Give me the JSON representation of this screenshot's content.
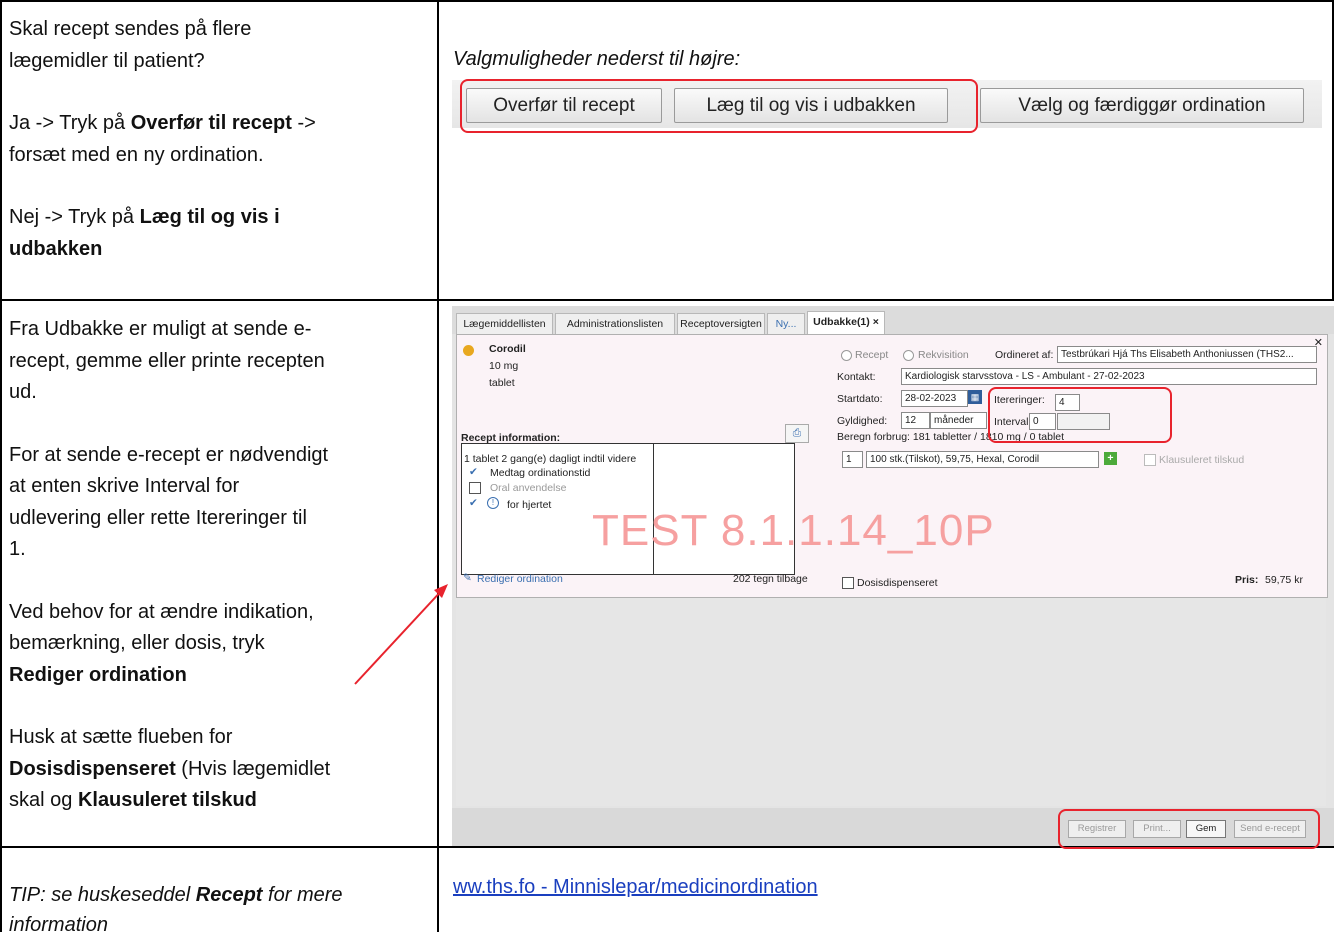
{
  "row1": {
    "question": [
      "Skal recept sendes på flere",
      "lægemidler til patient?"
    ],
    "yes_prefix": "Ja -> Tryk på ",
    "yes_bold": "Overfør til recept",
    "yes_suffix": " ->",
    "yes_line2": "forsæt med en ny ordination.",
    "no_prefix": "Nej -> Tryk på ",
    "no_bold1": "Læg til og vis i",
    "no_bold2": "udbakken",
    "options_label": "Valgmuligheder nederst til højre:",
    "buttons": [
      "Overfør til recept",
      "Læg til og vis i udbakken",
      "Vælg og færdiggør ordination"
    ]
  },
  "row2": {
    "p1": [
      "Fra Udbakke er muligt at sende e-",
      "recept, gemme eller printe recepten",
      "ud."
    ],
    "p2": [
      "For at sende e-recept er nødvendigt",
      "at enten skrive Interval for",
      "udlevering eller rette Itereringer til",
      "1."
    ],
    "p3": [
      "Ved behov for at ændre indikation,",
      "bemærkning, eller dosis, tryk"
    ],
    "p3_bold": "Rediger ordination",
    "p4_line1": "Husk at sætte flueben for",
    "p4_bold1": "Dosisdispenseret",
    "p4_rest1": " (Hvis lægemidlet",
    "p4_line3_prefix": "skal og ",
    "p4_bold2": "Klausuleret tilskud"
  },
  "screenshot": {
    "tabs": [
      "Lægemiddellisten",
      "Administrationslisten",
      "Receptoversigten",
      "Ny...",
      "Udbakke(1) ×"
    ],
    "drug_name": "Corodil",
    "strength": "10 mg",
    "form": "tablet",
    "recept_info": "Recept information:",
    "dosage": "1 tablet 2 gang(e) dagligt  indtil videre",
    "medtag": "Medtag ordinationstid",
    "oral": "Oral anvendelse",
    "indication": "for hjertet",
    "rediger": "Rediger ordination",
    "tegn": "202 tegn tilbage",
    "radio_recept": "Recept",
    "radio_rekvisition": "Rekvisition",
    "ordineret_label": "Ordineret af:",
    "ordineret_value": "Testbrúkari Hjá Ths Elisabeth Anthoniussen (THS2...",
    "kontakt_label": "Kontakt:",
    "kontakt_value": "Kardiologisk starvsstova - LS - Ambulant -  27-02-2023",
    "startdato_label": "Startdato:",
    "startdato_value": "28-02-2023",
    "itereringer_label": "Itereringer:",
    "itereringer_value": "4",
    "gyldighed_label": "Gyldighed:",
    "gyldighed_value": "12",
    "gyldighed_unit": "måneder",
    "interval_label": "Interval:",
    "interval_value": "0",
    "forbrug": "Beregn forbrug: 181 tabletter / 1810 mg / 0 tablet",
    "pakning_qty": "1",
    "pakning": "100 stk.(Tilskot), 59,75, Hexal, Corodil",
    "klausuleret": "Klausuleret tilskud",
    "dosisdisp": "Dosisdispenseret",
    "pris_label": "Pris:",
    "pris_value": "59,75 kr",
    "watermark": "TEST 8.1.1.14_10P",
    "bottom_buttons": [
      "Registrer",
      "Print...",
      "Gem",
      "Send e-recept"
    ]
  },
  "row3": {
    "tip_prefix": "TIP: se huskeseddel ",
    "tip_bold": "Recept",
    "tip_suffix": " for mere",
    "tip_line2": "information",
    "link": "ww.ths.fo - Minnislepar/medicinordination"
  },
  "colors": {
    "highlight": "#e8232d",
    "link": "#1a3fbf",
    "watermark": "#f6a0a0"
  }
}
